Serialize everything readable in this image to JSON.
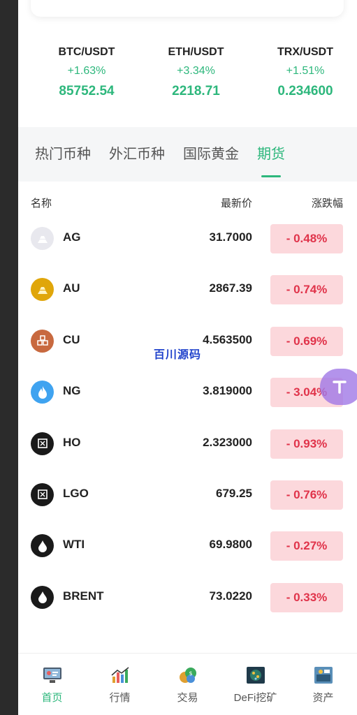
{
  "tickers": [
    {
      "pair": "BTC/USDT",
      "change": "+1.63%",
      "price": "85752.54"
    },
    {
      "pair": "ETH/USDT",
      "change": "+3.34%",
      "price": "2218.71"
    },
    {
      "pair": "TRX/USDT",
      "change": "+1.51%",
      "price": "0.234600"
    }
  ],
  "tabs": [
    {
      "label": "热门币种"
    },
    {
      "label": "外汇币种"
    },
    {
      "label": "国际黄金"
    },
    {
      "label": "期货"
    }
  ],
  "list_header": {
    "name": "名称",
    "price": "最新价",
    "change": "涨跌幅"
  },
  "rows": [
    {
      "name": "AG",
      "price": "31.7000",
      "change": "- 0.48%",
      "icon": "silver-bars-icon"
    },
    {
      "name": "AU",
      "price": "2867.39",
      "change": "- 0.74%",
      "icon": "gold-bars-icon"
    },
    {
      "name": "CU",
      "price": "4.563500",
      "change": "- 0.69%",
      "icon": "copper-blocks-icon"
    },
    {
      "name": "NG",
      "price": "3.819000",
      "change": "- 3.04%",
      "icon": "flame-icon"
    },
    {
      "name": "HO",
      "price": "2.323000",
      "change": "- 0.93%",
      "icon": "oil-barrel-icon"
    },
    {
      "name": "LGO",
      "price": "679.25",
      "change": "- 0.76%",
      "icon": "oil-barrel-icon"
    },
    {
      "name": "WTI",
      "price": "69.9800",
      "change": "- 0.27%",
      "icon": "oil-drop-icon"
    },
    {
      "name": "BRENT",
      "price": "73.0220",
      "change": "- 0.33%",
      "icon": "oil-drop-icon"
    }
  ],
  "watermark": "百川源码",
  "bottom_nav": [
    {
      "label": "首页",
      "icon": "home-screen-icon"
    },
    {
      "label": "行情",
      "icon": "market-chart-icon"
    },
    {
      "label": "交易",
      "icon": "coins-icon"
    },
    {
      "label": "DeFi挖矿",
      "icon": "mining-icon"
    },
    {
      "label": "资产",
      "icon": "assets-icon"
    }
  ],
  "colors": {
    "accent": "#2db77c",
    "down": "#e0334a",
    "down_bg": "#fcd8dc"
  }
}
